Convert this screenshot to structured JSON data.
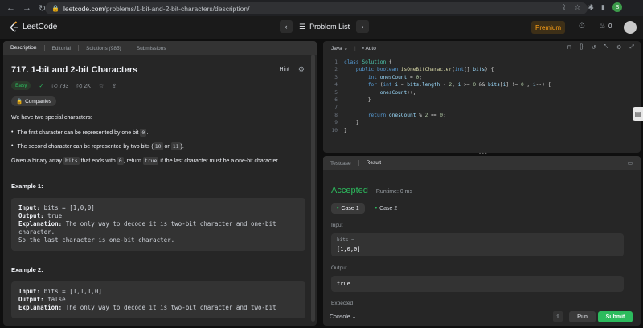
{
  "browser": {
    "url_host": "leetcode.com",
    "url_path": "/problems/1-bit-and-2-bit-characters/description/",
    "profile_initial": "S"
  },
  "nav": {
    "logo_text": "LeetCode",
    "problem_list": "Problem List",
    "premium": "Premium",
    "streak_count": "0"
  },
  "left_tabs": [
    "Description",
    "Editorial",
    "Solutions (985)",
    "Submissions"
  ],
  "problem": {
    "title": "717. 1-bit and 2-bit Characters",
    "hint": "Hint",
    "difficulty": "Easy",
    "likes": "793",
    "dislikes": "2K",
    "companies": "Companies",
    "intro": "We have two special characters:",
    "bullet1_text": "The first character can be represented by one bit",
    "bullet1_code": "0",
    "bullet2_text": "The second character can be represented by two bits (",
    "bullet2_code1": "10",
    "bullet2_or": "or",
    "bullet2_code2": "11",
    "bullet2_end": ").",
    "given_1": "Given a binary array",
    "given_code1": "bits",
    "given_2": "that ends with",
    "given_code2": "0",
    "given_3": ", return",
    "given_code3": "true",
    "given_4": "if the last character must be a one-bit character."
  },
  "examples": [
    {
      "title": "Example 1:",
      "input_label": "Input:",
      "input": "bits = [1,0,0]",
      "output_label": "Output:",
      "output": "true",
      "expl_label": "Explanation:",
      "expl1": "The only way to decode it is two-bit character and one-bit",
      "expl2": "character.",
      "expl3": "So the last character is one-bit character."
    },
    {
      "title": "Example 2:",
      "input_label": "Input:",
      "input": "bits = [1,1,1,0]",
      "output_label": "Output:",
      "output": "false",
      "expl_label": "Explanation:",
      "expl1": "The only way to decode it is two-bit character and two-bit"
    }
  ],
  "editor": {
    "language": "Java",
    "mode": "Auto",
    "lines": [
      "1",
      "2",
      "3",
      "4",
      "5",
      "6",
      "7",
      "8",
      "9",
      "10"
    ]
  },
  "result": {
    "tabs": [
      "Testcase",
      "Result"
    ],
    "status": "Accepted",
    "runtime": "Runtime: 0 ms",
    "cases": [
      "Case 1",
      "Case 2"
    ],
    "input_label": "Input",
    "input_key": "bits =",
    "input_value": "[1,0,0]",
    "output_label": "Output",
    "output_value": "true",
    "expected_label": "Expected",
    "console": "Console",
    "run": "Run",
    "submit": "Submit"
  },
  "colors": {
    "accent_green": "#2cbb5d",
    "premium_orange": "#ffa116",
    "panel_bg": "#262626"
  }
}
